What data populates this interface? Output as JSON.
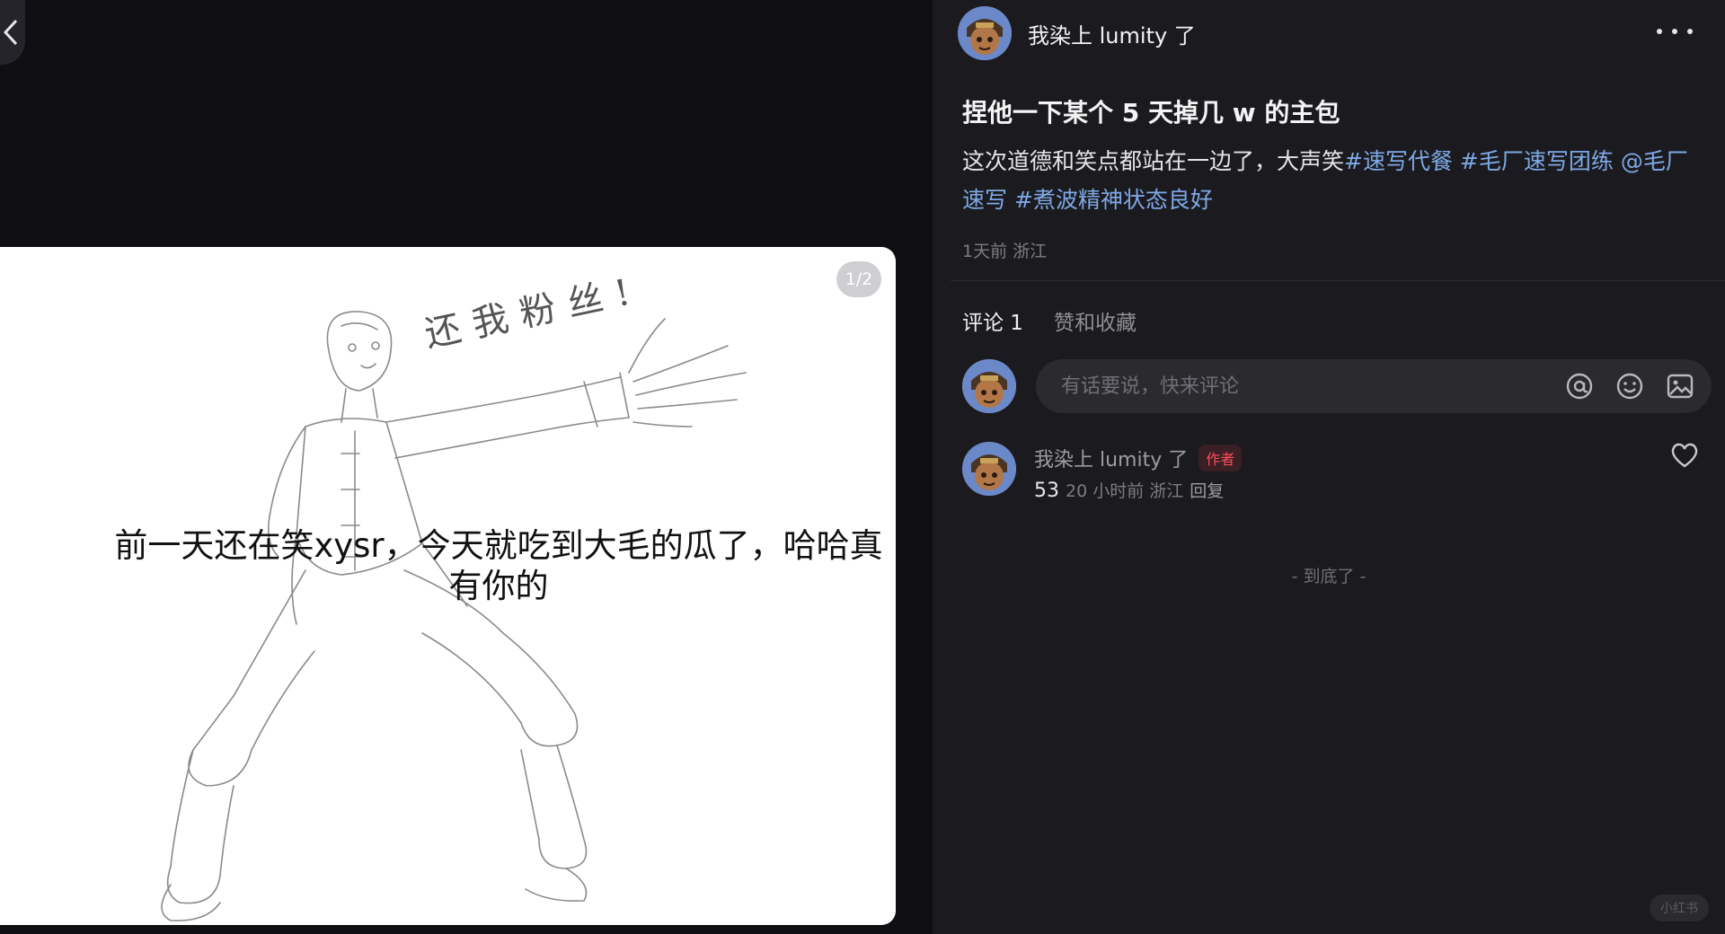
{
  "viewer": {
    "counter": "1/2",
    "caption": "前一天还在笑xysr，今天就吃到大毛的瓜了，哈哈真有你的",
    "handwriting": "还我粉丝!"
  },
  "author": {
    "name": "我染上 lumity 了"
  },
  "post": {
    "title": "捏他一下某个 5 天掉几 w 的主包",
    "body_text": "这次道德和笑点都站在一边了，大声笑",
    "tag1": "#速写代餐",
    "tag2": "#毛厂速写团练",
    "mention": "@毛厂速写",
    "tag3": "#煮波精神状态良好",
    "meta": "1天前 浙江"
  },
  "tabs": {
    "comments": "评论 1",
    "likes": "赞和收藏"
  },
  "composer": {
    "placeholder": "有话要说，快来评论"
  },
  "comment": {
    "name": "我染上 lumity 了",
    "badge": "作者",
    "text": "53",
    "meta": "20 小时前 浙江",
    "reply": "回复"
  },
  "end_text": "- 到底了 -",
  "watermark": "小红书"
}
